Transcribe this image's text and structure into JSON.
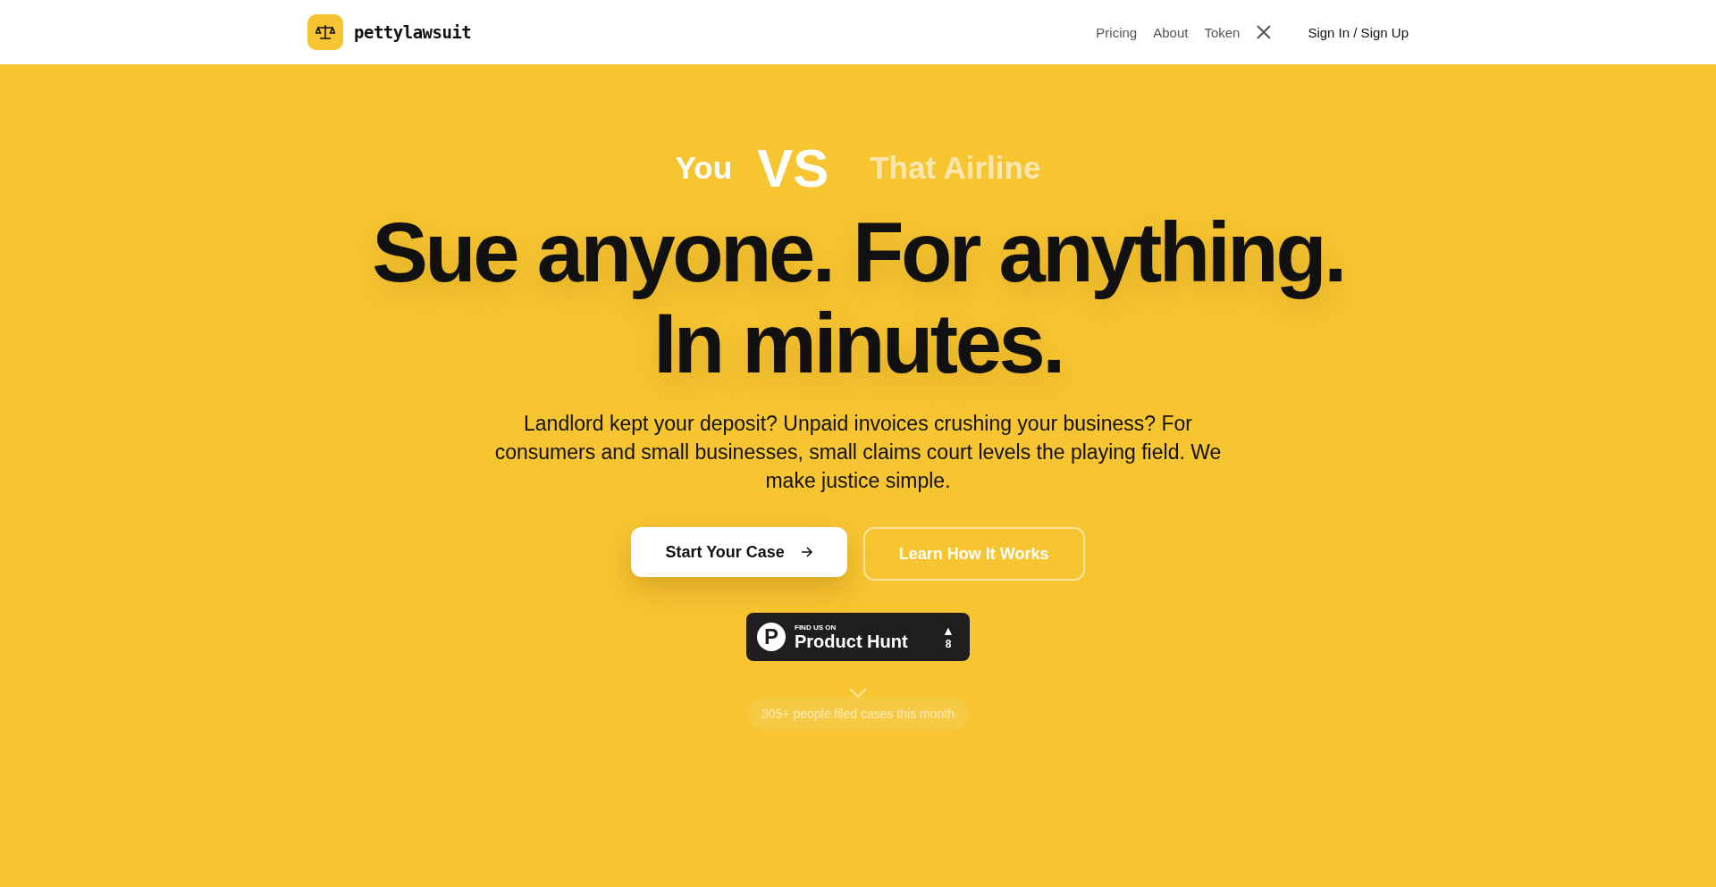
{
  "header": {
    "brand": "pettylawsuit",
    "nav": [
      {
        "label": "Pricing"
      },
      {
        "label": "About"
      },
      {
        "label": "Token"
      }
    ],
    "sign_in": "Sign In / Sign Up"
  },
  "hero": {
    "versus": {
      "left": "You",
      "middle": "VS",
      "right": "That Airline"
    },
    "headline_lines": [
      "Sue anyone. For anything.",
      "In minutes."
    ],
    "subtitle": "Landlord kept your deposit? Unpaid invoices crushing your business? For consumers and small businesses, small claims court levels the playing field. We make justice simple.",
    "buttons": [
      {
        "kind": "primary",
        "label": "Start Your Case"
      },
      {
        "kind": "outline",
        "label": "Learn How It Works"
      }
    ],
    "product_hunt": {
      "logo_letter": "P",
      "caption": "FIND US ON",
      "name": "Product Hunt",
      "arrow": "▲",
      "votes": "8"
    },
    "stat": "305+ people filed cases this month"
  }
}
